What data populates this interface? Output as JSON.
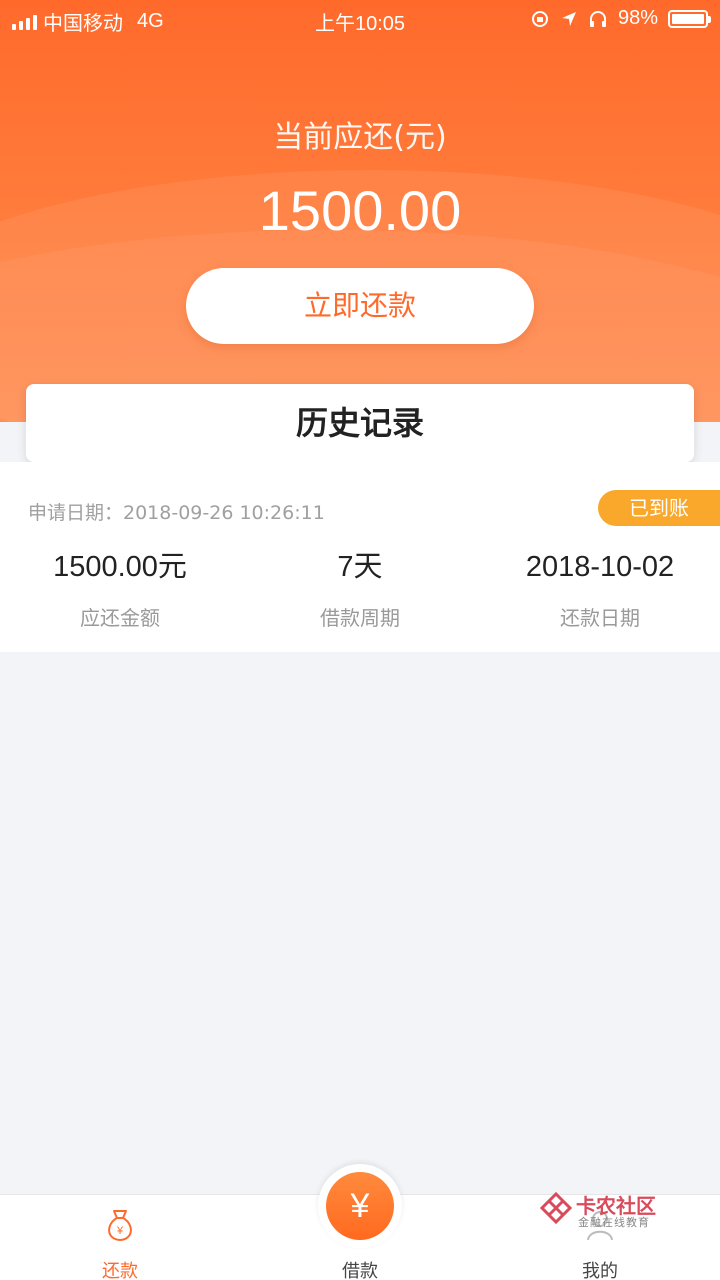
{
  "status_bar": {
    "carrier": "中国移动",
    "network": "4G",
    "time": "上午10:05",
    "battery": "98%"
  },
  "header": {
    "title": "当前应还(元)",
    "amount": "1500.00",
    "repay_button": "立即还款"
  },
  "history": {
    "title": "历史记录"
  },
  "record": {
    "apply_date": "申请日期：2018-09-26 10:26:11",
    "status": "已到账",
    "amount_value": "1500.00元",
    "amount_label": "应还金额",
    "period_value": "7天",
    "period_label": "借款周期",
    "due_date_value": "2018-10-02",
    "due_date_label": "还款日期"
  },
  "tabbar": {
    "tabs": [
      {
        "label": "还款",
        "icon": "money-bag-icon",
        "active": true
      },
      {
        "label": "借款",
        "icon": "yuan-icon",
        "active": false
      },
      {
        "label": "我的",
        "icon": "user-icon",
        "active": false
      }
    ],
    "center_symbol": "¥"
  },
  "watermark": {
    "title": "卡农社区",
    "subtitle": "金融在线教育"
  },
  "colors": {
    "primary": "#ff6a2b",
    "badge": "#f9a82c",
    "background": "#f2f4f7"
  }
}
